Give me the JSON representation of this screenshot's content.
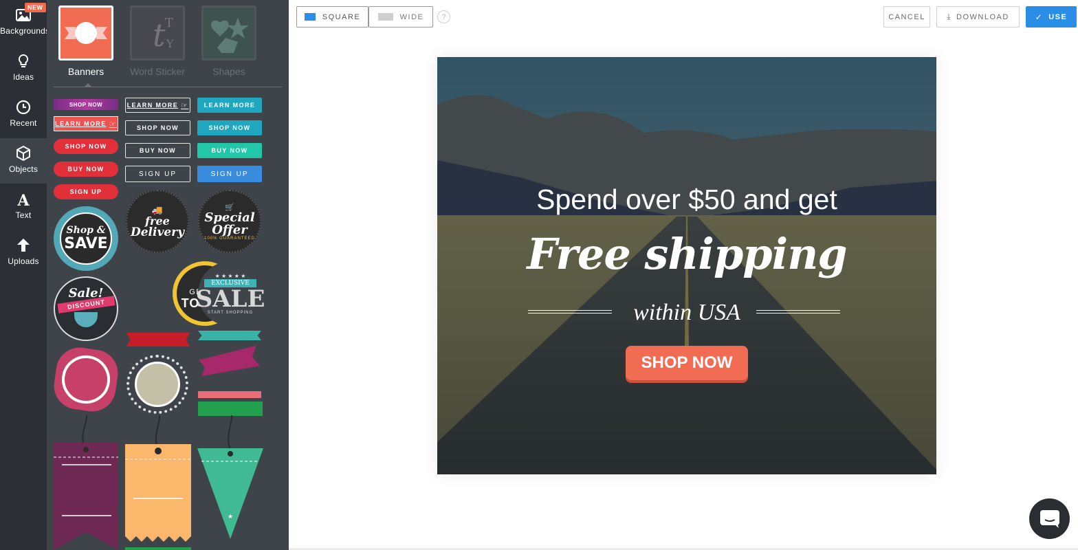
{
  "sidebar": {
    "new_badge": "NEW",
    "items": [
      {
        "label": "Backgrounds",
        "icon": "image-icon"
      },
      {
        "label": "Ideas",
        "icon": "lightbulb-icon"
      },
      {
        "label": "Recent",
        "icon": "clock-icon"
      },
      {
        "label": "Objects",
        "icon": "cube-icon",
        "active": true
      },
      {
        "label": "Text",
        "icon": "text-a-icon"
      },
      {
        "label": "Uploads",
        "icon": "upload-arrow-icon"
      }
    ]
  },
  "library": {
    "categories": [
      {
        "label": "Banners",
        "active": true
      },
      {
        "label": "Word Sticker",
        "active": false
      },
      {
        "label": "Shapes",
        "active": false
      }
    ],
    "buttons": {
      "col1": [
        "SHOP NOW",
        "LEARN MORE",
        "SHOP NOW",
        "BUY NOW",
        "SIGN UP"
      ],
      "col2": [
        "LEARN MORE",
        "SHOP NOW",
        "BUY NOW",
        "SIGN UP"
      ],
      "col3": [
        "LEARN MORE",
        "SHOP NOW",
        "BUY NOW",
        "SIGN UP"
      ]
    },
    "badges": {
      "shop_save": [
        "Shop &",
        "SAVE"
      ],
      "free_delivery": [
        "free",
        "Delivery"
      ],
      "special_offer": [
        "Special",
        "Offer",
        "100% GUARANTEED"
      ],
      "sale_discount": [
        "Sale!",
        "DISCOUNT"
      ],
      "get_in_touch": [
        "GET IN",
        "TOUCH"
      ],
      "exclusive_sale": [
        "EXCLUSIVE",
        "SALE",
        "START SHOPPING"
      ]
    }
  },
  "toolbar": {
    "square_label": "SQUARE",
    "wide_label": "WIDE",
    "help_label": "?",
    "cancel_label": "CANCEL",
    "download_label": "DOWNLOAD",
    "use_label": "USE"
  },
  "design": {
    "line1": "Spend over $50 and get",
    "line2": "Free shipping",
    "line3": "within USA",
    "cta": "SHOP NOW"
  },
  "colors": {
    "accent_blue": "#2a8ee6",
    "cta_coral": "#f26b53",
    "rail_bg": "#2c3036",
    "panel_bg": "#3e4449"
  }
}
